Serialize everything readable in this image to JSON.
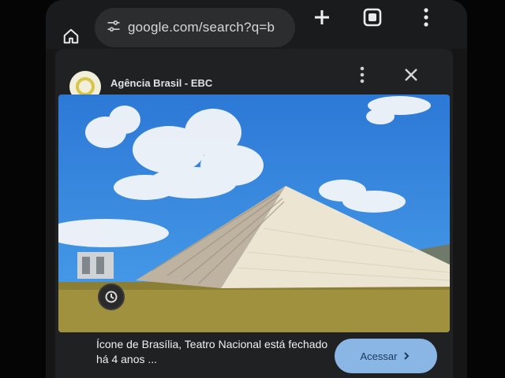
{
  "browser": {
    "url": "google.com/search?q=b",
    "home_icon": "home-icon",
    "tune_icon": "tune-icon",
    "new_tab_icon": "plus-icon",
    "tabs_icon": "tabs-icon",
    "menu_icon": "more-vert-icon"
  },
  "card": {
    "source_name": "Agência Brasil - EBC",
    "headline": "Ícone de Brasília, Teatro Nacional está fechado há 4 anos ...",
    "cta_label": "Acessar",
    "menu_icon": "more-vert-icon",
    "close_icon": "close-icon",
    "lens_icon": "lens-icon"
  },
  "colors": {
    "sky": "#2f7fd8",
    "pyramid": "#e7dfc9",
    "grass": "#a0913e",
    "cta": "#8ab6e6"
  }
}
